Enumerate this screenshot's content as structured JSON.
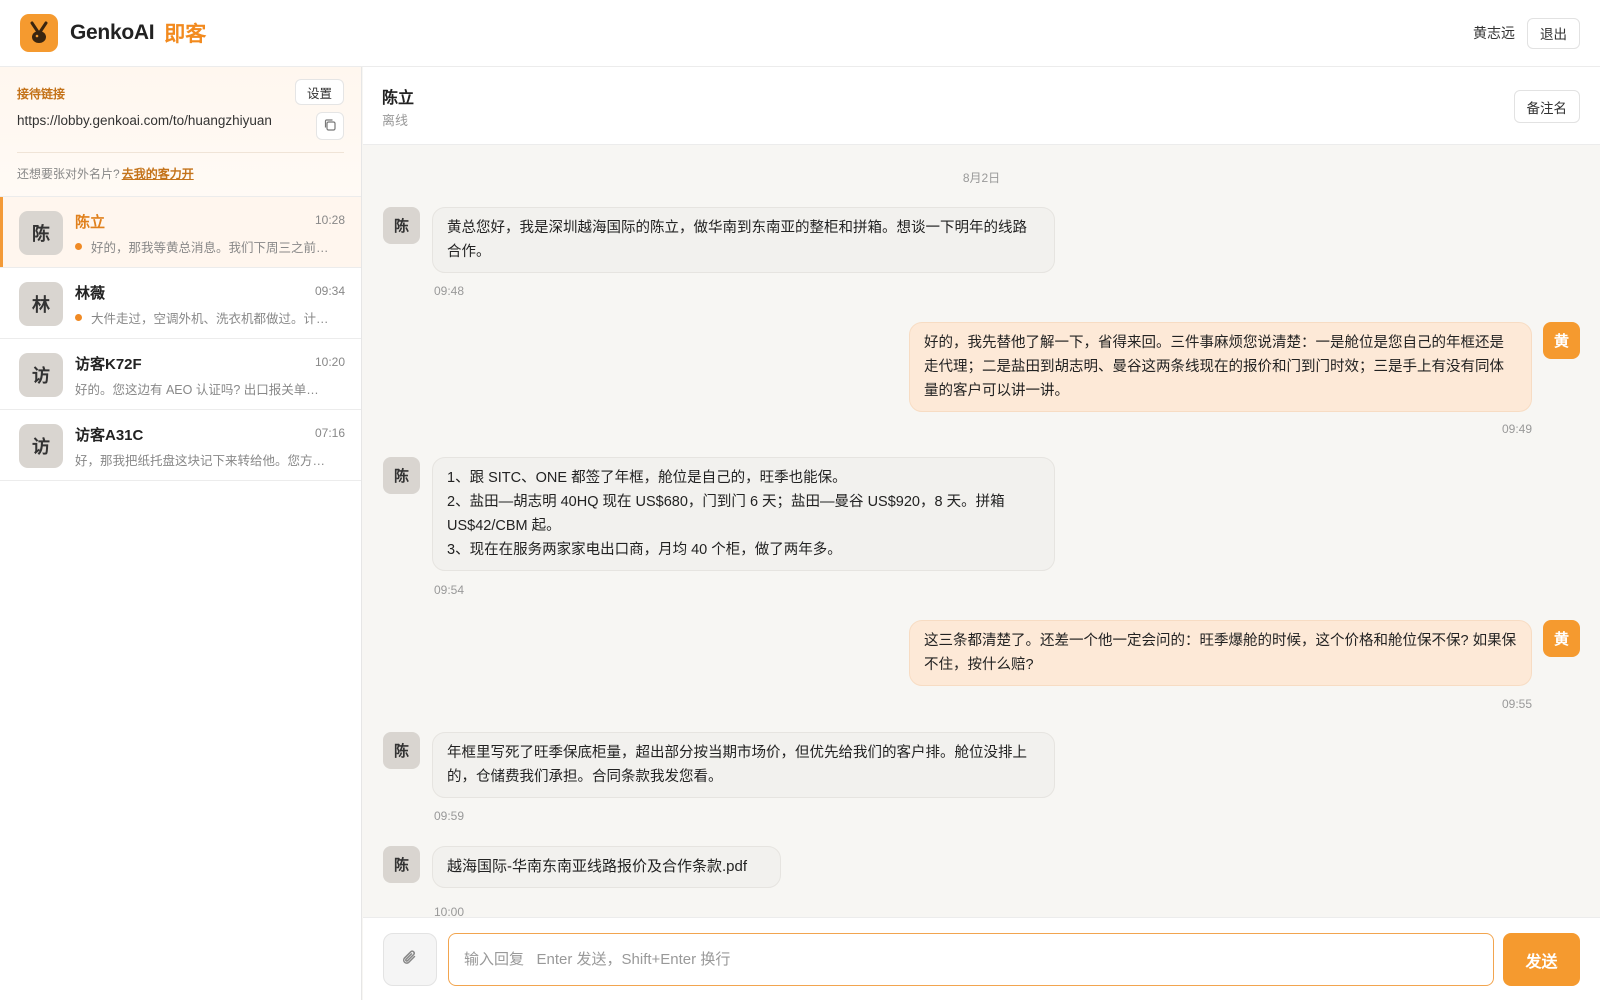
{
  "colors": {
    "accent": "#f59a2f",
    "accent_text": "#e0801c",
    "unread_dot": "#f08a24",
    "my_bubble": "#fde9d7",
    "their_bubble": "#f2f1ee"
  },
  "header": {
    "brand": "GenkoAI",
    "brand_cn": "即客",
    "logo_icon": "rabbit-logo-icon",
    "user_name": "黄志远",
    "logout_label": "退出"
  },
  "sidebar": {
    "link_panel": {
      "label": "接待链接",
      "settings_label": "设置",
      "url": "https://lobby.genkoai.com/to/huangzhiyuan",
      "copy_icon": "copy-icon",
      "promo_text": "还想要张对外名片?",
      "promo_link": "去我的客力开"
    },
    "conversations": [
      {
        "avatar": "陈",
        "name": "陈立",
        "time": "10:28",
        "preview": "好的，那我等黄总消息。我们下周三之前…",
        "unread": true,
        "active": true
      },
      {
        "avatar": "林",
        "name": "林薇",
        "time": "09:34",
        "preview": "大件走过，空调外机、洗衣机都做过。计…",
        "unread": true,
        "active": false
      },
      {
        "avatar": "访",
        "name": "访客K72F",
        "time": "10:20",
        "preview": "好的。您这边有 AEO 认证吗? 出口报关单…",
        "unread": false,
        "active": false
      },
      {
        "avatar": "访",
        "name": "访客A31C",
        "time": "07:16",
        "preview": "好，那我把纸托盘这块记下来转给他。您方…",
        "unread": false,
        "active": false
      }
    ]
  },
  "chat": {
    "name": "陈立",
    "status": "离线",
    "remark_label": "备注名",
    "date": "8月2日",
    "messages": [
      {
        "from": "them",
        "avatar": "陈",
        "text": "黄总您好，我是深圳越海国际的陈立，做华南到东南亚的整柜和拼箱。想谈一下明年的线路合作。",
        "time": "09:48"
      },
      {
        "from": "me",
        "avatar": "黄",
        "text": "好的，我先替他了解一下，省得来回。三件事麻烦您说清楚：一是舱位是您自己的年框还是走代理；二是盐田到胡志明、曼谷这两条线现在的报价和门到门时效；三是手上有没有同体量的客户可以讲一讲。",
        "time": "09:49"
      },
      {
        "from": "them",
        "avatar": "陈",
        "text": "1、跟 SITC、ONE 都签了年框，舱位是自己的，旺季也能保。\n2、盐田—胡志明 40HQ 现在 US$680，门到门 6 天；盐田—曼谷 US$920，8 天。拼箱 US$42/CBM 起。\n3、现在在服务两家家电出口商，月均 40 个柜，做了两年多。",
        "time": "09:54"
      },
      {
        "from": "me",
        "avatar": "黄",
        "text": "这三条都清楚了。还差一个他一定会问的：旺季爆舱的时候，这个价格和舱位保不保? 如果保不住，按什么赔?",
        "time": "09:55"
      },
      {
        "from": "them",
        "avatar": "陈",
        "text": "年框里写死了旺季保底柜量，超出部分按当期市场价，但优先给我们的客户排。舱位没排上的，仓储费我们承担。合同条款我发您看。",
        "time": "09:59"
      },
      {
        "from": "them",
        "avatar": "陈",
        "text": "越海国际-华南东南亚线路报价及合作条款.pdf",
        "time": "10:00"
      }
    ]
  },
  "composer": {
    "attach_icon": "paperclip-icon",
    "placeholder": "输入回复   Enter 发送，Shift+Enter 换行",
    "value": "",
    "send_label": "发送"
  }
}
